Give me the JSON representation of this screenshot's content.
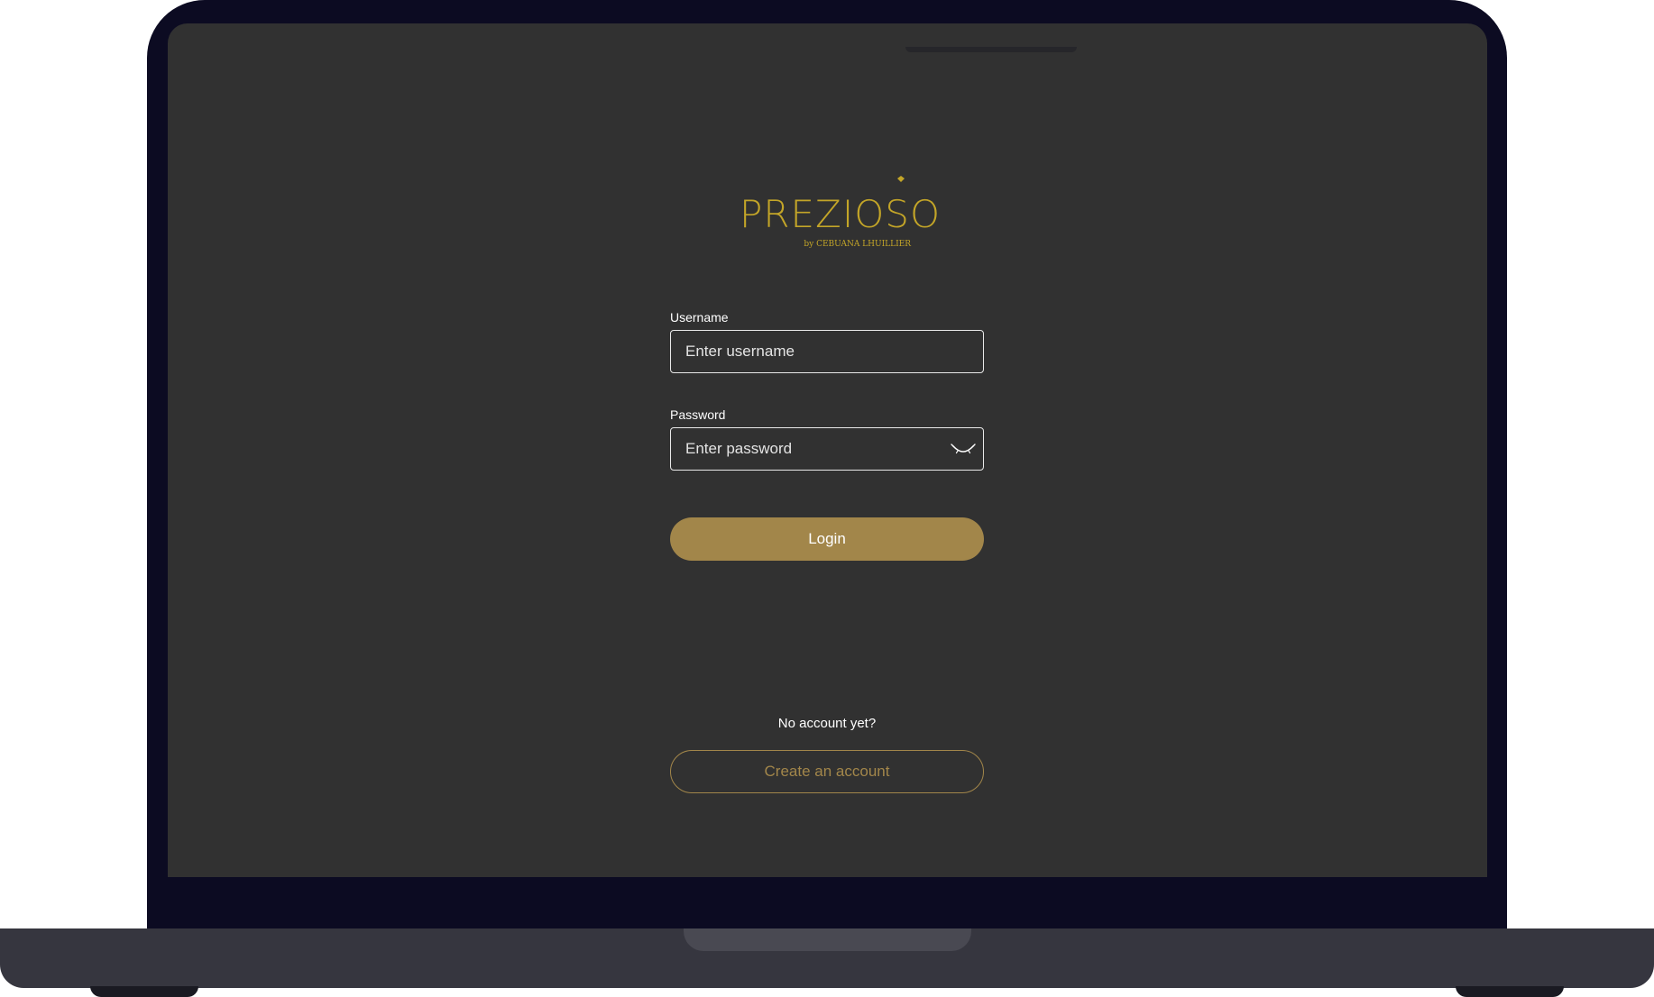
{
  "brand": {
    "name": "PREZIOSO",
    "name_main": "PREZIOS",
    "name_last": "O",
    "subtitle": "by CEBUANA LHUILLIER",
    "color": "#c3a528"
  },
  "login_form": {
    "username_label": "Username",
    "username_placeholder": "Enter username",
    "password_label": "Password",
    "password_placeholder": "Enter password",
    "toggle_visibility_icon": "eye-closed-icon",
    "login_label": "Login"
  },
  "signup": {
    "prompt": "No account yet?",
    "create_label": "Create an account"
  },
  "colors": {
    "screen_bg": "#313131",
    "accent": "#a2864a",
    "bezel": "#0c0b22"
  }
}
